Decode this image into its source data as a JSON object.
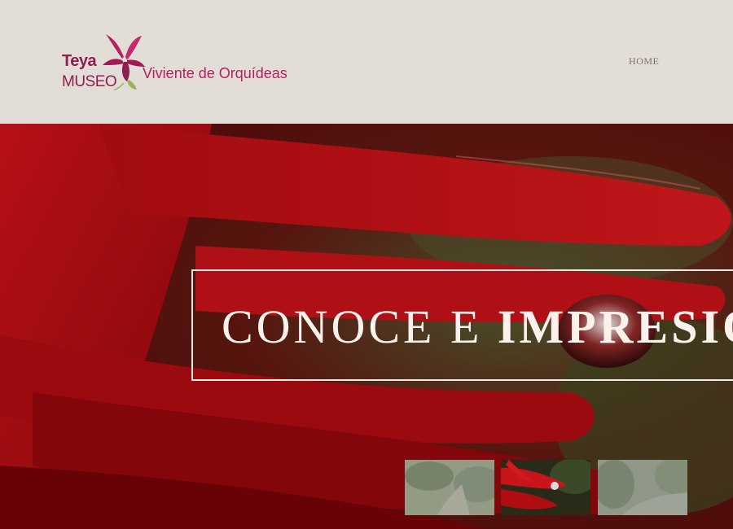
{
  "logo": {
    "line1": "Teya",
    "line2": "MUSEO",
    "subtitle": "Viviente de Orquídeas"
  },
  "nav": {
    "home_label": "HOME"
  },
  "hero": {
    "headline_light": "CONOCE E ",
    "headline_bold": "IMPRESIO"
  },
  "thumbnails": [
    {
      "name": "garden-path-thumbnail",
      "active": false
    },
    {
      "name": "red-flower-thumbnail",
      "active": true
    },
    {
      "name": "garden-stream-thumbnail",
      "active": false
    }
  ],
  "colors": {
    "brand": "#8e1e4f",
    "accent": "#b5205f",
    "header_bg": "#e3ddd7",
    "hero_red": "#b40c12"
  }
}
